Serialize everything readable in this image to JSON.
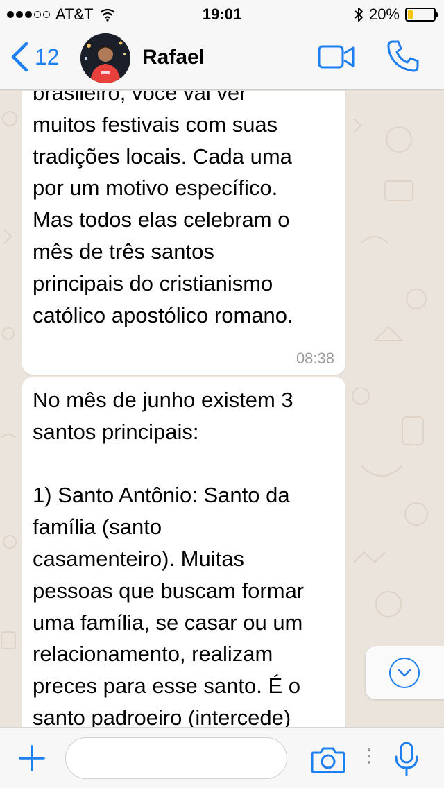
{
  "status_bar": {
    "carrier": "AT&T",
    "time": "19:01",
    "battery": "20%",
    "battery_level": 0.2
  },
  "header": {
    "back_count": "12",
    "contact_name": "Rafael"
  },
  "messages": [
    {
      "text": "brasileiro, você vai ver\nmuitos festivais com suas\ntradições locais. Cada uma\npor um motivo específico.\nMas todos elas celebram o\nmês de três santos\nprincipais do cristianismo\ncatólico apostólico romano.",
      "time": "08:38"
    },
    {
      "text": "No mês de junho existem 3\nsantos principais:\n\n1) Santo Antônio: Santo da\nfamília (santo\ncasamenteiro). Muitas\npessoas que buscam formar\numa família, se casar ou um\nrelacionamento, realizam\npreces para esse santo. É o\nsanto padroeiro (intercede)"
    }
  ],
  "input": {
    "placeholder": ""
  },
  "icons": {
    "back": "chevron-left-icon",
    "video": "video-camera-icon",
    "call": "phone-icon",
    "add": "plus-icon",
    "camera": "camera-icon",
    "mic": "microphone-icon",
    "scroll": "chevron-down-icon"
  },
  "colors": {
    "accent": "#1e7ff0",
    "battery_fill": "#f5c518",
    "chat_background": "#ebe4dc",
    "bubble": "#ffffff"
  }
}
